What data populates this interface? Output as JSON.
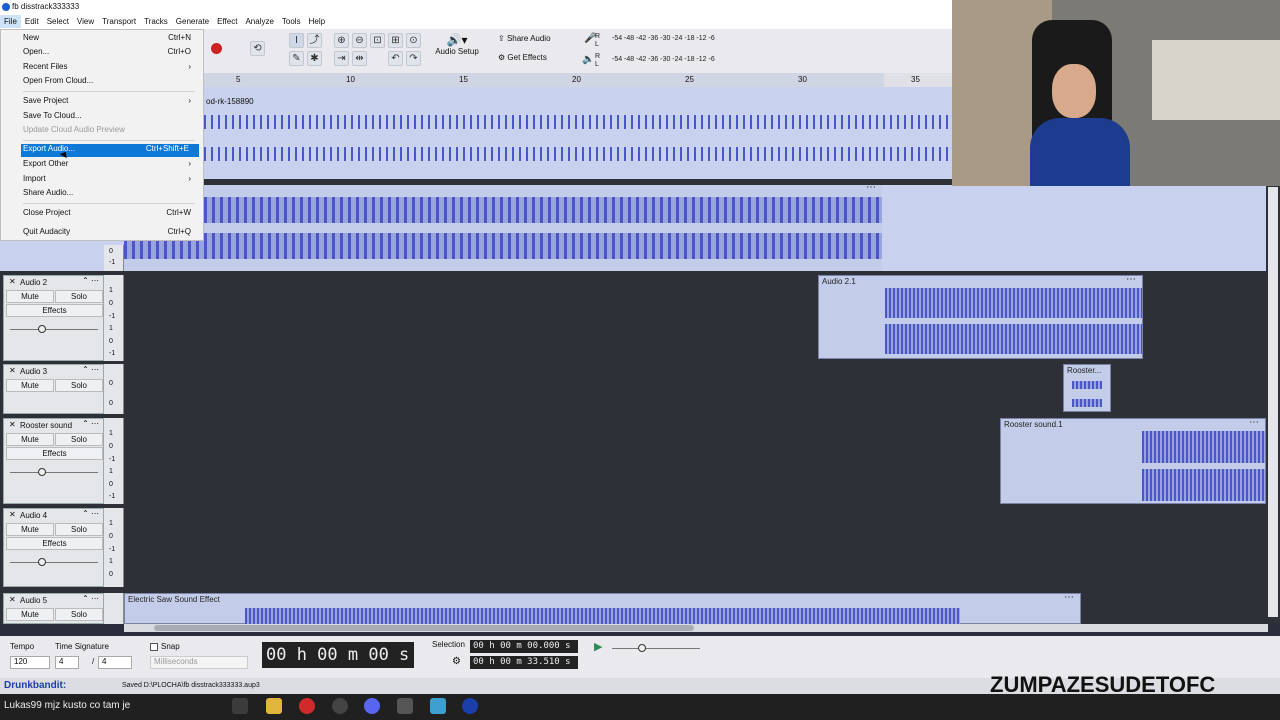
{
  "window": {
    "title": "fb disstrack333333"
  },
  "menubar": [
    "File",
    "Edit",
    "Select",
    "View",
    "Transport",
    "Tracks",
    "Generate",
    "Effect",
    "Analyze",
    "Tools",
    "Help"
  ],
  "file_menu": {
    "items": [
      {
        "label": "New",
        "shortcut": "Ctrl+N"
      },
      {
        "label": "Open...",
        "shortcut": "Ctrl+O"
      },
      {
        "label": "Recent Files",
        "shortcut": "›"
      },
      {
        "label": "Open From Cloud...",
        "shortcut": ""
      },
      {
        "label": "Save Project",
        "shortcut": "›"
      },
      {
        "label": "Save To Cloud...",
        "shortcut": ""
      },
      {
        "label": "Update Cloud Audio Preview",
        "shortcut": "",
        "disabled": true
      },
      {
        "label": "Export Audio...",
        "shortcut": "Ctrl+Shift+E",
        "highlighted": true
      },
      {
        "label": "Export Other",
        "shortcut": "›"
      },
      {
        "label": "Import",
        "shortcut": "›"
      },
      {
        "label": "Share Audio...",
        "shortcut": ""
      },
      {
        "label": "Close Project",
        "shortcut": "Ctrl+W"
      },
      {
        "label": "Quit Audacity",
        "shortcut": "Ctrl+Q"
      }
    ]
  },
  "toolbar": {
    "share_audio": "Share Audio",
    "get_effects": "Get Effects",
    "audio_setup": "Audio Setup",
    "meter_ticks": "-54 -48 -42 -36 -30 -24 -18 -12 -6",
    "meter_r": "R",
    "meter_l": "L"
  },
  "ruler": {
    "ticks": [
      "5",
      "10",
      "15",
      "20",
      "25",
      "30",
      "35"
    ]
  },
  "tracks": [
    {
      "name": "Audio 2",
      "clip": "Audio 2.1",
      "mute": "Mute",
      "solo": "Solo",
      "effects": "Effects"
    },
    {
      "name": "Audio 3",
      "clip": "Rooster...",
      "mute": "Mute",
      "solo": "Solo"
    },
    {
      "name": "Rooster sound",
      "clip": "Rooster sound.1",
      "mute": "Mute",
      "solo": "Solo",
      "effects": "Effects"
    },
    {
      "name": "Audio 4",
      "clip": "",
      "mute": "Mute",
      "solo": "Solo",
      "effects": "Effects"
    },
    {
      "name": "Audio 5",
      "clip": "Electric Saw Sound Effect",
      "mute": "Mute",
      "solo": "Solo"
    }
  ],
  "top_clip": {
    "label": "od-rk-158890"
  },
  "scale_labels": {
    "one": "1",
    "zero": "0",
    "neg": "-1"
  },
  "bottom": {
    "tempo_label": "Tempo",
    "tempo": "120",
    "time_sig_label": "Time Signature",
    "ts_num": "4",
    "ts_den": "4",
    "ts_slash": "/",
    "snap_label": "Snap",
    "snap_unit": "Milliseconds",
    "main_time": "00 h 00 m 00 s",
    "selection_label": "Selection",
    "sel_start": "00 h 00 m 00.000 s",
    "sel_end": "00 h 00 m 33.510 s"
  },
  "status": {
    "saved": "Saved D:\\PLOCHA\\fb disstrack333333.aup3"
  },
  "overlay": {
    "chat_user": "Drunkbandit:",
    "chat_line": "Lukas99 mjz kusto co tam je",
    "watermark": "ZUMPAZESUDETOFC"
  },
  "colors": {
    "accent": "#0e78d7",
    "waveform": "#4b56c8",
    "clip_bg": "#c3cdea",
    "record": "#cc2222"
  }
}
